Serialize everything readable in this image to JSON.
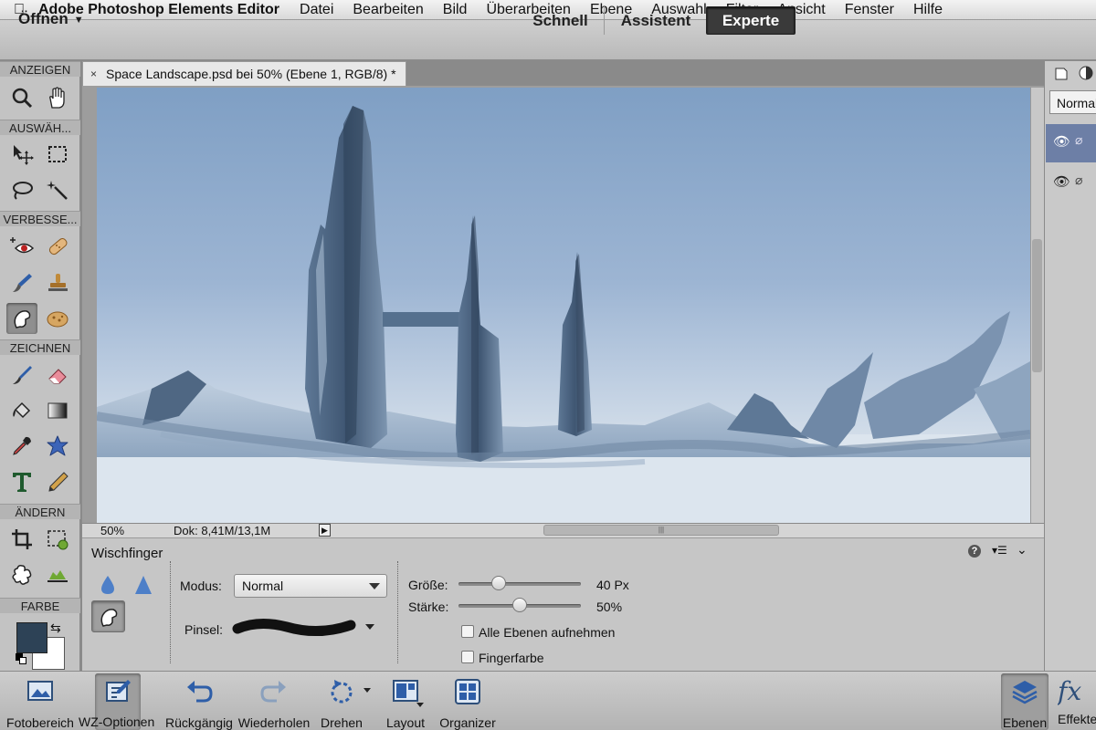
{
  "menubar": {
    "app_name": "Adobe Photoshop Elements Editor",
    "items": [
      "Datei",
      "Bearbeiten",
      "Bild",
      "Überarbeiten",
      "Ebene",
      "Auswahl",
      "Filter",
      "Ansicht",
      "Fenster",
      "Hilfe"
    ]
  },
  "topbar": {
    "open_label": "Öffnen",
    "modes": [
      "Schnell",
      "Assistent",
      "Experte"
    ],
    "active_mode": "Experte"
  },
  "toolbox": {
    "sections": [
      "ANZEIGEN",
      "AUSWÄH...",
      "VERBESSE...",
      "ZEICHNEN",
      "ÄNDERN",
      "FARBE"
    ],
    "foreground_color": "#2d4256",
    "background_color": "#ffffff"
  },
  "document": {
    "tab_title": "Space Landscape.psd bei 50% (Ebene 1, RGB/8) *",
    "close_glyph": "×"
  },
  "statusbar": {
    "zoom": "50%",
    "doc_size": "Dok: 8,41M/13,1M"
  },
  "tool_options": {
    "tool_name": "Wischfinger",
    "mode_label": "Modus:",
    "mode_value": "Normal",
    "brush_label": "Pinsel:",
    "size_label": "Größe:",
    "size_value": "40 Px",
    "size_fraction": 0.33,
    "strength_label": "Stärke:",
    "strength_value": "50%",
    "strength_fraction": 0.5,
    "all_layers_label": "Alle Ebenen aufnehmen",
    "finger_paint_label": "Fingerfarbe"
  },
  "right_panel": {
    "blend_mode": "Normal"
  },
  "bottombar": {
    "items": [
      "Fotobereich",
      "WZ-Optionen",
      "Rückgängig",
      "Wiederholen",
      "Drehen",
      "Layout",
      "Organizer",
      "Ebenen",
      "Effekte"
    ]
  }
}
